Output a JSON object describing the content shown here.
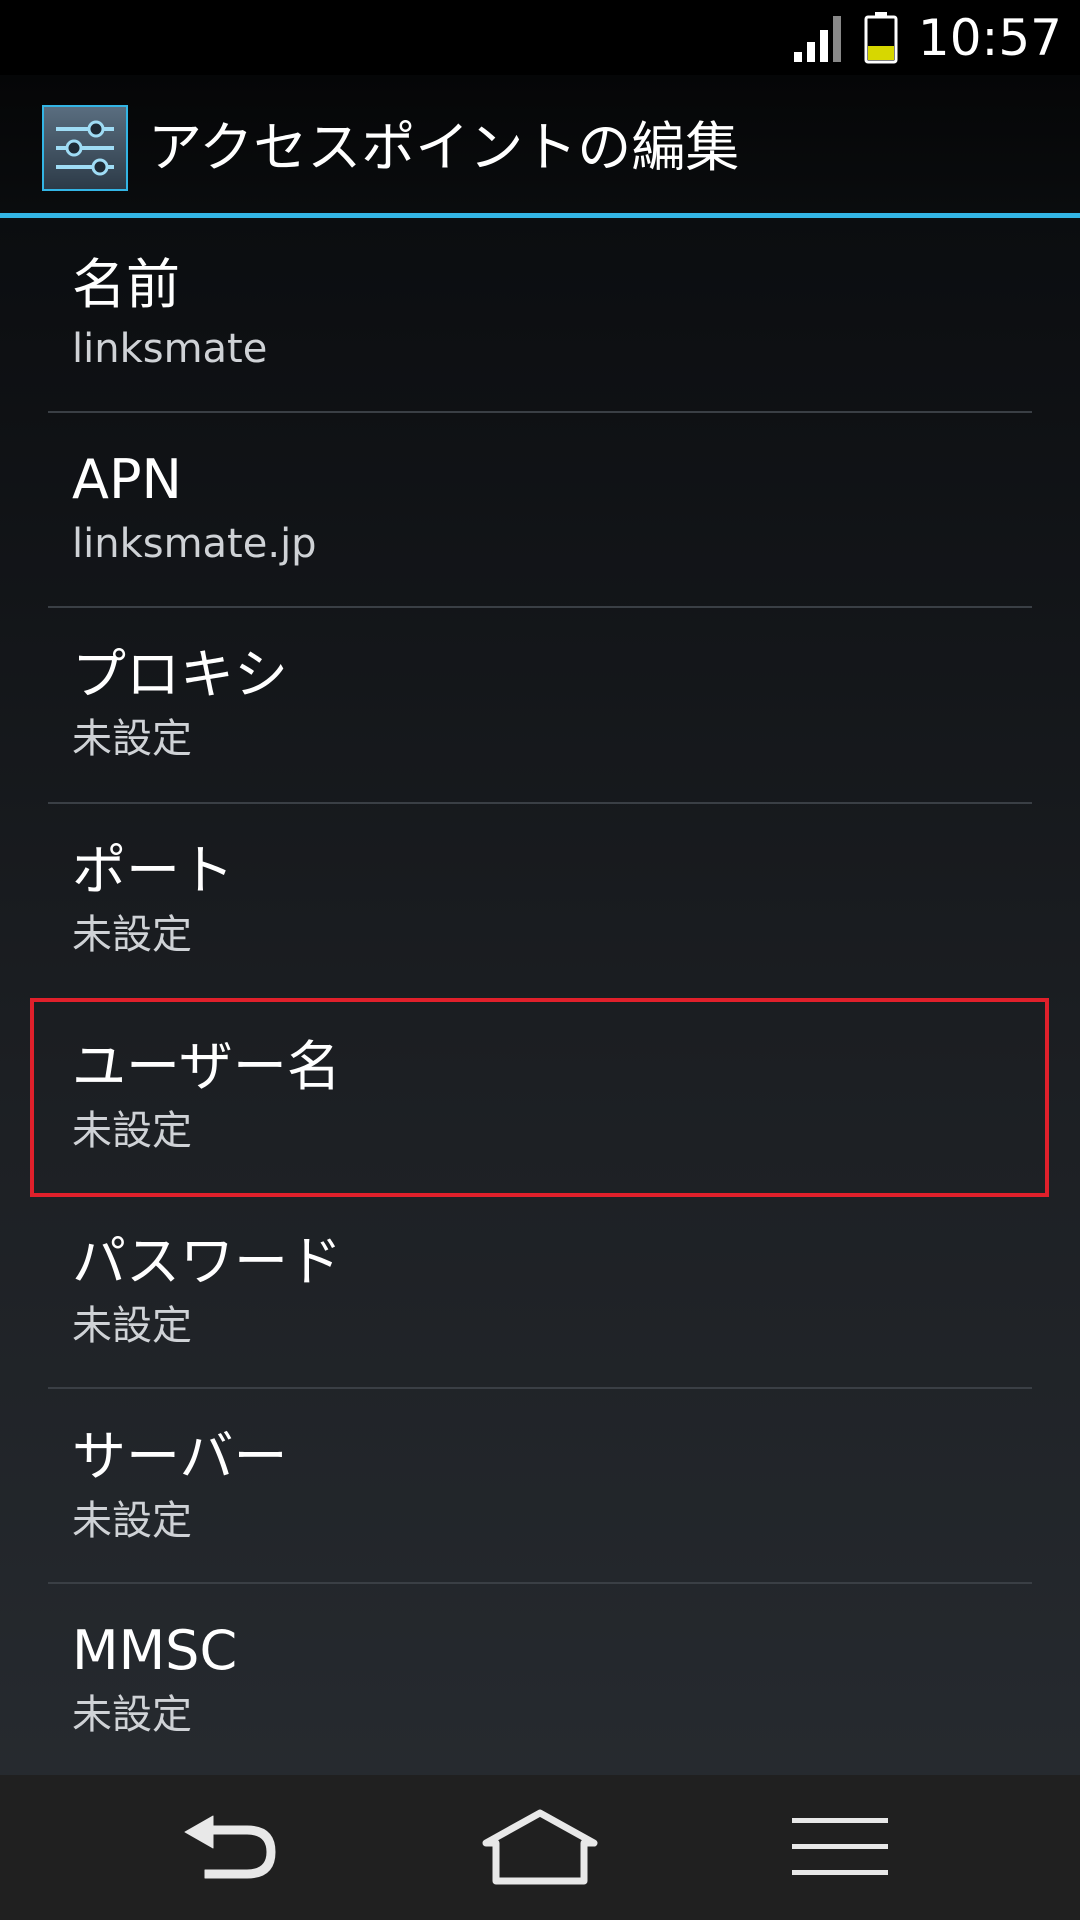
{
  "status_bar": {
    "time": "10:57",
    "battery_color": "#d7d700"
  },
  "action_bar": {
    "title": "アクセスポイントの編集",
    "accent_color": "#33b5e5"
  },
  "settings": [
    {
      "label": "名前",
      "value": "linksmate"
    },
    {
      "label": "APN",
      "value": "linksmate.jp"
    },
    {
      "label": "プロキシ",
      "value": "未設定"
    },
    {
      "label": "ポート",
      "value": "未設定"
    },
    {
      "label": "ユーザー名",
      "value": "未設定",
      "highlighted": true
    },
    {
      "label": "パスワード",
      "value": "未設定"
    },
    {
      "label": "サーバー",
      "value": "未設定"
    },
    {
      "label": "MMSC",
      "value": "未設定"
    }
  ],
  "highlight_color": "#e0202b",
  "nav_bar": {
    "buttons": [
      "back-icon",
      "home-icon",
      "menu-icon"
    ]
  }
}
